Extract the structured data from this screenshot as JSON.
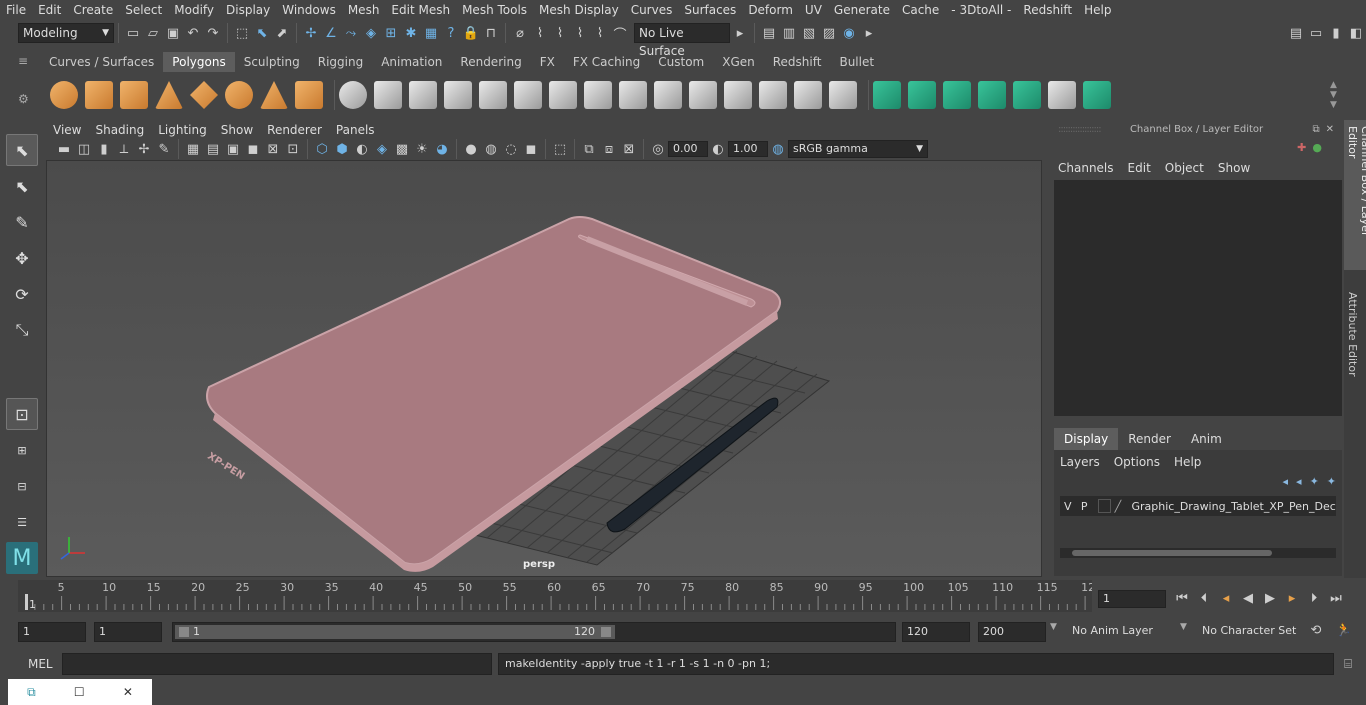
{
  "menubar": [
    "File",
    "Edit",
    "Create",
    "Select",
    "Modify",
    "Display",
    "Windows",
    "Mesh",
    "Edit Mesh",
    "Mesh Tools",
    "Mesh Display",
    "Curves",
    "Surfaces",
    "Deform",
    "UV",
    "Generate",
    "Cache",
    "- 3DtoAll -",
    "Redshift",
    "Help"
  ],
  "status": {
    "mode": "Modeling",
    "live_surface": "No Live Surface"
  },
  "shelf_tabs": [
    "Curves / Surfaces",
    "Polygons",
    "Sculpting",
    "Rigging",
    "Animation",
    "Rendering",
    "FX",
    "FX Caching",
    "Custom",
    "XGen",
    "Redshift",
    "Bullet"
  ],
  "shelf_active": "Polygons",
  "viewport": {
    "menu": [
      "View",
      "Shading",
      "Lighting",
      "Show",
      "Renderer",
      "Panels"
    ],
    "exposure": "0.00",
    "gamma": "1.00",
    "colorspace": "sRGB gamma",
    "camera": "persp",
    "logo_text": "XP-PEN"
  },
  "channelbox": {
    "title": "Channel Box / Layer Editor",
    "menu": [
      "Channels",
      "Edit",
      "Object",
      "Show"
    ],
    "layer_tabs": [
      "Display",
      "Render",
      "Anim"
    ],
    "layer_menu": [
      "Layers",
      "Options",
      "Help"
    ],
    "layer": {
      "v": "V",
      "p": "P",
      "name": "Graphic_Drawing_Tablet_XP_Pen_Deco_P"
    },
    "side_tabs": [
      "Channel Box / Layer Editor",
      "Attribute Editor"
    ]
  },
  "timeline": {
    "ticks": [
      "5",
      "10",
      "15",
      "20",
      "25",
      "30",
      "35",
      "40",
      "45",
      "50",
      "55",
      "60",
      "65",
      "70",
      "75",
      "80",
      "85",
      "90",
      "95",
      "100",
      "105",
      "110",
      "115",
      "12"
    ],
    "start_marker": "1",
    "current_frame": "1"
  },
  "range": {
    "start": "1",
    "start2": "1",
    "slider_start": "1",
    "slider_end": "120",
    "end": "120",
    "end2": "200",
    "anim_layer": "No Anim Layer",
    "char_set": "No Character Set"
  },
  "cmd": {
    "label": "MEL",
    "output": "makeIdentity -apply true -t 1 -r 1 -s 1 -n 0 -pn 1;"
  }
}
